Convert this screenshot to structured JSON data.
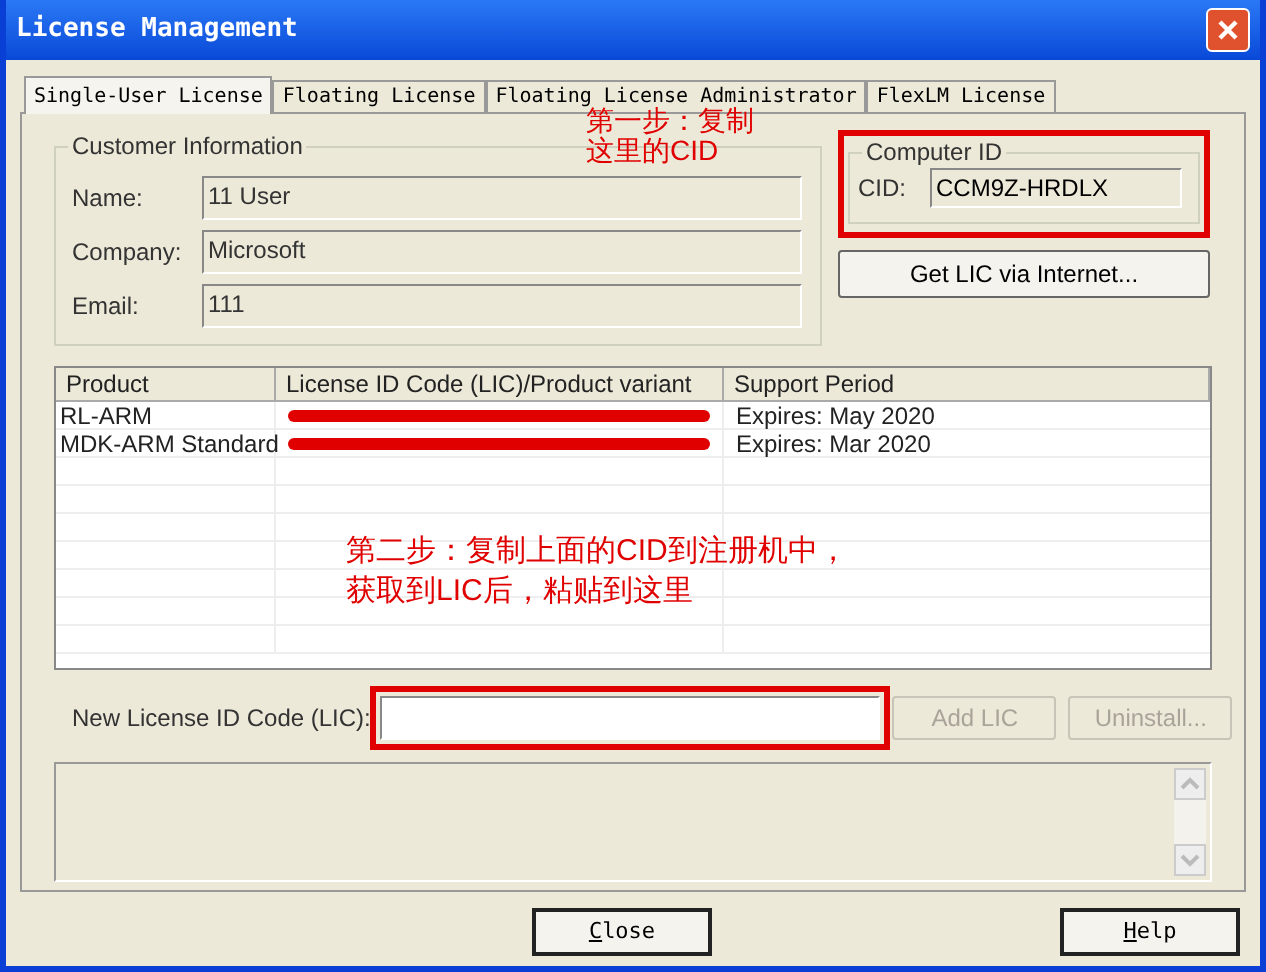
{
  "window": {
    "title": "License Management"
  },
  "tabs": [
    {
      "label": "Single-User License",
      "selected": true
    },
    {
      "label": "Floating License",
      "selected": false
    },
    {
      "label": "Floating License Administrator",
      "selected": false
    },
    {
      "label": "FlexLM License",
      "selected": false
    }
  ],
  "customer_information": {
    "title": "Customer Information",
    "fields": [
      {
        "label": "Name:",
        "value": "11 User"
      },
      {
        "label": "Company:",
        "value": "Microsoft"
      },
      {
        "label": "Email:",
        "value": "111"
      }
    ]
  },
  "annotation_1": {
    "lines": [
      "第一步：复制",
      "这里的CID"
    ]
  },
  "computer_id": {
    "title": "Computer ID",
    "label": "CID:",
    "value": "CCM9Z-HRDLX"
  },
  "get_lic_button": "Get LIC via Internet...",
  "table": {
    "columns": [
      "Product",
      "License ID Code (LIC)/Product variant",
      "Support Period"
    ],
    "rows": [
      {
        "product": "RL-ARM",
        "lic_redacted": true,
        "support": "Expires: May 2020"
      },
      {
        "product": "MDK-ARM Standard",
        "lic_redacted": true,
        "support": "Expires: Mar 2020"
      }
    ]
  },
  "annotation_2": {
    "lines": [
      "第二步：复制上面的CID到注册机中，",
      "获取到LIC后，粘贴到这里"
    ]
  },
  "new_lic": {
    "label": "New License ID Code (LIC):"
  },
  "buttons": [
    {
      "label": "Add LIC",
      "disabled": true
    },
    {
      "label": "Uninstall...",
      "disabled": true
    }
  ],
  "footer_buttons": [
    "Close",
    "Help"
  ]
}
